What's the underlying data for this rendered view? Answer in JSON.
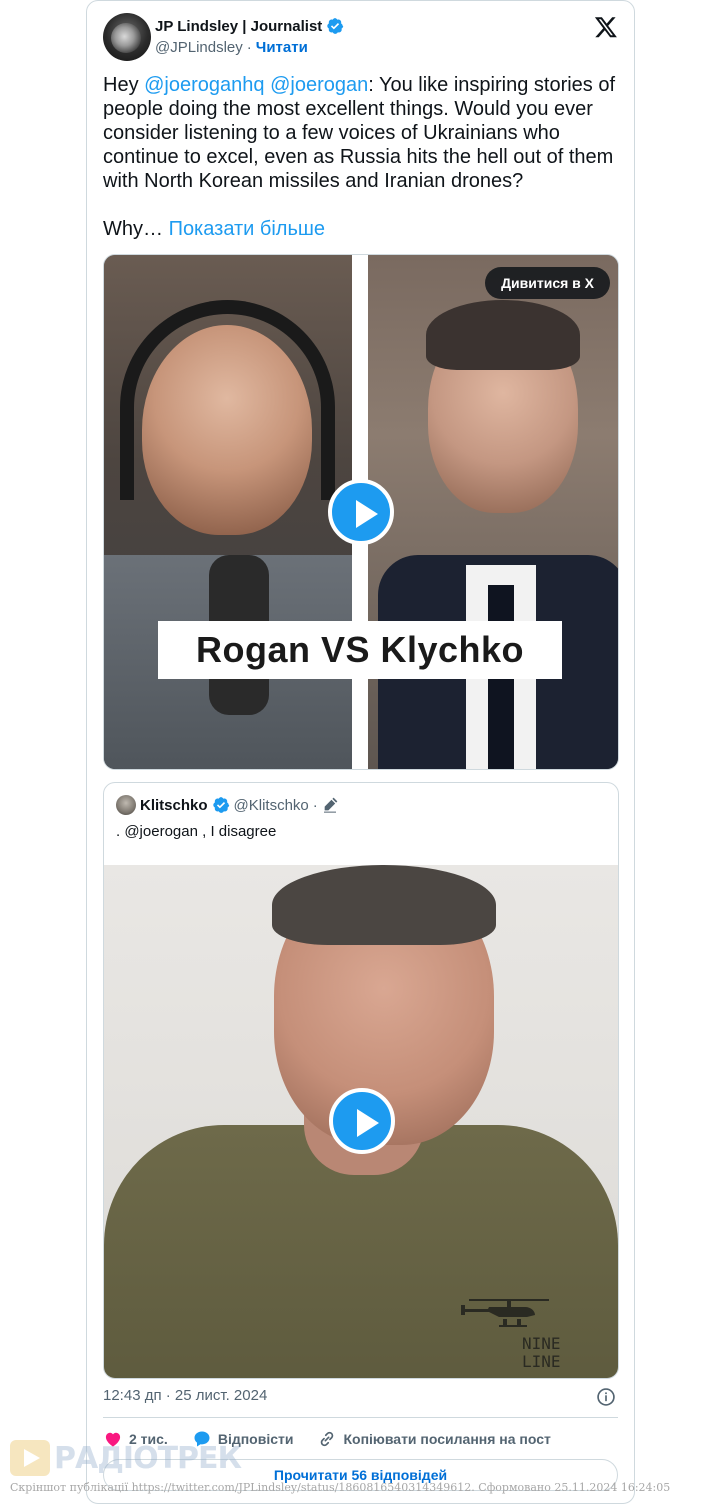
{
  "author": {
    "name": "JP Lindsley | Journalist",
    "handle": "@JPLindsley",
    "separator": "·",
    "follow_label": "Читати"
  },
  "tweet": {
    "text_before": "Hey ",
    "mention1": "@joeroganhq",
    "space": " ",
    "mention2": "@joerogan",
    "text_after": ": You like inspiring stories of people doing the most excellent things. Would you ever consider listening to a few voices of Ukrainians who continue to excel, even as Russia hits the hell out of them with North Korean missiles and Iranian drones?\n\nWhy… ",
    "show_more": "Показати більше"
  },
  "media1": {
    "overlay_title": "Rogan VS Klychko",
    "watch_label": "Дивитися в X"
  },
  "quote": {
    "name": "Klitschko",
    "handle": "@Klitschko",
    "separator": "·",
    "text": ". @joerogan , I disagree",
    "shirt_text": "NINE\nLINE"
  },
  "timestamp": "12:43 дп · 25 лист. 2024",
  "actions": {
    "likes": "2 тис.",
    "reply": "Відповісти",
    "copy_link": "Копіювати посилання на пост"
  },
  "read_replies": "Прочитати 56 відповідей",
  "watermark": {
    "logo_text": "РАДІОТРЕК",
    "caption": "Скріншот публікації https://twitter.com/JPLindsley/status/1860816540314349612. Сформовано 25.11.2024 16:24:05"
  },
  "colors": {
    "accent": "#1d9bf0",
    "like": "#f91880",
    "text": "#0f1419",
    "muted": "#536471",
    "border": "#cfd9de"
  },
  "icons": [
    "verified-badge-icon",
    "x-logo-icon",
    "play-icon",
    "edit-icon",
    "info-icon",
    "heart-icon",
    "reply-bubble-icon",
    "link-icon"
  ]
}
